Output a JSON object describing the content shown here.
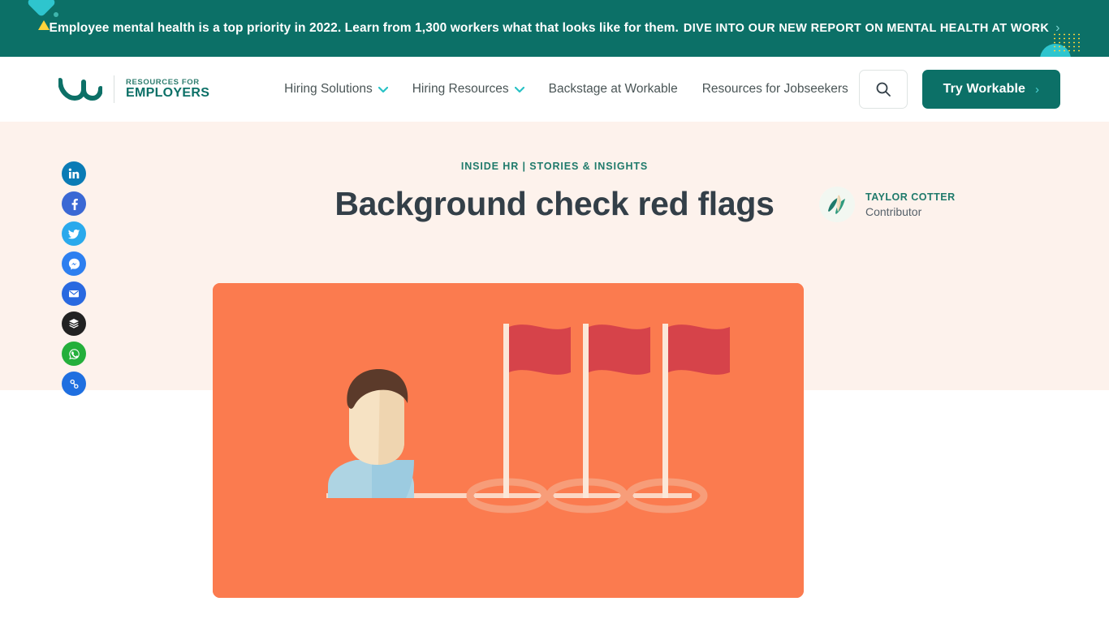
{
  "promo": {
    "message": "Employee mental health is a top priority in 2022. Learn from 1,300 workers what that looks like for them.",
    "cta": "DIVE INTO OUR NEW REPORT ON MENTAL HEALTH AT WORK",
    "chevron": "›",
    "background": "#0c7067"
  },
  "header": {
    "brand": {
      "line1": "RESOURCES FOR",
      "line2": "EMPLOYERS",
      "logo_icon": "workable-logo-icon"
    },
    "nav": [
      {
        "label": "Hiring Solutions",
        "has_dropdown": true
      },
      {
        "label": "Hiring Resources",
        "has_dropdown": true
      },
      {
        "label": "Backstage at Workable",
        "has_dropdown": false
      },
      {
        "label": "Resources for Jobseekers",
        "has_dropdown": false
      }
    ],
    "search_icon": "search-icon",
    "cta": {
      "label": "Try Workable",
      "chevron": "›",
      "background": "#0c7067"
    }
  },
  "article": {
    "eyebrow": "INSIDE HR | STORIES & INSIGHTS",
    "title": "Background check red flags",
    "title_color": "#333f48",
    "eyebrow_color": "#1f7a6b",
    "band_background": "#fdf2ec",
    "author": {
      "name": "TAYLOR COTTER",
      "role": "Contributor",
      "avatar_icon": "quill-leaf-avatar-icon"
    },
    "hero": {
      "background": "#fb7b4f",
      "flag_color": "#d6434a",
      "pole_color": "#fbe7d8",
      "base_ring_color": "#f79d79",
      "hair_color": "#5b3a2a",
      "skin_color": "#f6e2c3",
      "shirt_color": "#aed4e3",
      "flag_count": 3,
      "alt": "person connected by a line to three red flags"
    }
  },
  "social_share": [
    {
      "name": "linkedin",
      "label": "Share on LinkedIn",
      "color": "#0a7bb5"
    },
    {
      "name": "facebook",
      "label": "Share on Facebook",
      "color": "#3a68d4"
    },
    {
      "name": "twitter",
      "label": "Share on Twitter",
      "color": "#2aa9ec"
    },
    {
      "name": "messenger",
      "label": "Share on Messenger",
      "color": "#2d7ff0"
    },
    {
      "name": "email",
      "label": "Share by Email",
      "color": "#2969e0"
    },
    {
      "name": "buffer",
      "label": "Share on Buffer",
      "color": "#222222"
    },
    {
      "name": "whatsapp",
      "label": "Share on WhatsApp",
      "color": "#24af3b"
    },
    {
      "name": "copy-link",
      "label": "Copy link",
      "color": "#1f6fe0"
    }
  ]
}
